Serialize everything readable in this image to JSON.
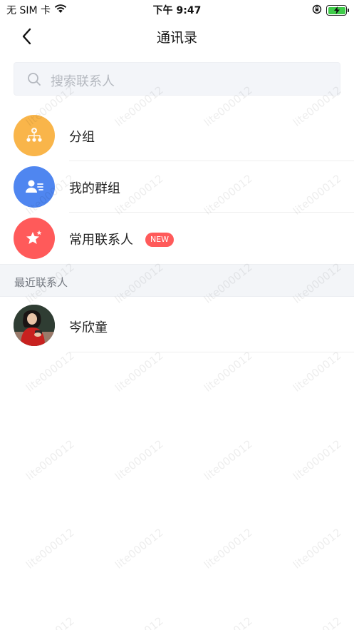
{
  "status_bar": {
    "carrier": "无 SIM 卡",
    "time": "下午 9:47"
  },
  "nav": {
    "title": "通讯录",
    "back_icon": "chevron-left-icon"
  },
  "search": {
    "placeholder": "搜索联系人"
  },
  "menu": [
    {
      "label": "分组",
      "icon": "group-tree-icon",
      "color": "#f9b54a"
    },
    {
      "label": "我的群组",
      "icon": "user-list-icon",
      "color": "#4f86f0"
    },
    {
      "label": "常用联系人",
      "icon": "star-icon",
      "color": "#ff5a5a",
      "badge": "NEW"
    }
  ],
  "recent": {
    "header": "最近联系人",
    "contacts": [
      {
        "name": "岑欣童"
      }
    ]
  },
  "watermark": "lite000012"
}
